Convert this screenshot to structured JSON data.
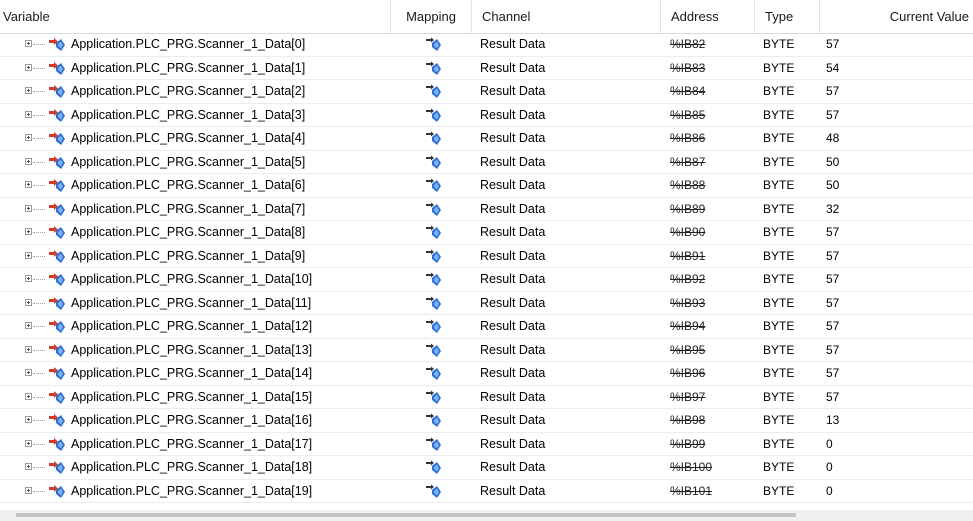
{
  "columns": {
    "variable": "Variable",
    "mapping": "Mapping",
    "channel": "Channel",
    "address": "Address",
    "type": "Type",
    "current_value": "Current Value"
  },
  "icons": {
    "variable": "variable-input-icon",
    "mapping": "mapping-arrow-icon",
    "expander": "plus-expander-icon"
  },
  "colors": {
    "icon_blue": "#2b6fd6",
    "icon_red": "#d23c2a"
  },
  "rows": [
    {
      "variable": "Application.PLC_PRG.Scanner_1_Data[0]",
      "channel": "Result Data",
      "address": "%IB82",
      "type": "BYTE",
      "value": "57"
    },
    {
      "variable": "Application.PLC_PRG.Scanner_1_Data[1]",
      "channel": "Result Data",
      "address": "%IB83",
      "type": "BYTE",
      "value": "54"
    },
    {
      "variable": "Application.PLC_PRG.Scanner_1_Data[2]",
      "channel": "Result Data",
      "address": "%IB84",
      "type": "BYTE",
      "value": "57"
    },
    {
      "variable": "Application.PLC_PRG.Scanner_1_Data[3]",
      "channel": "Result Data",
      "address": "%IB85",
      "type": "BYTE",
      "value": "57"
    },
    {
      "variable": "Application.PLC_PRG.Scanner_1_Data[4]",
      "channel": "Result Data",
      "address": "%IB86",
      "type": "BYTE",
      "value": "48"
    },
    {
      "variable": "Application.PLC_PRG.Scanner_1_Data[5]",
      "channel": "Result Data",
      "address": "%IB87",
      "type": "BYTE",
      "value": "50"
    },
    {
      "variable": "Application.PLC_PRG.Scanner_1_Data[6]",
      "channel": "Result Data",
      "address": "%IB88",
      "type": "BYTE",
      "value": "50"
    },
    {
      "variable": "Application.PLC_PRG.Scanner_1_Data[7]",
      "channel": "Result Data",
      "address": "%IB89",
      "type": "BYTE",
      "value": "32"
    },
    {
      "variable": "Application.PLC_PRG.Scanner_1_Data[8]",
      "channel": "Result Data",
      "address": "%IB90",
      "type": "BYTE",
      "value": "57"
    },
    {
      "variable": "Application.PLC_PRG.Scanner_1_Data[9]",
      "channel": "Result Data",
      "address": "%IB91",
      "type": "BYTE",
      "value": "57"
    },
    {
      "variable": "Application.PLC_PRG.Scanner_1_Data[10]",
      "channel": "Result Data",
      "address": "%IB92",
      "type": "BYTE",
      "value": "57"
    },
    {
      "variable": "Application.PLC_PRG.Scanner_1_Data[11]",
      "channel": "Result Data",
      "address": "%IB93",
      "type": "BYTE",
      "value": "57"
    },
    {
      "variable": "Application.PLC_PRG.Scanner_1_Data[12]",
      "channel": "Result Data",
      "address": "%IB94",
      "type": "BYTE",
      "value": "57"
    },
    {
      "variable": "Application.PLC_PRG.Scanner_1_Data[13]",
      "channel": "Result Data",
      "address": "%IB95",
      "type": "BYTE",
      "value": "57"
    },
    {
      "variable": "Application.PLC_PRG.Scanner_1_Data[14]",
      "channel": "Result Data",
      "address": "%IB96",
      "type": "BYTE",
      "value": "57"
    },
    {
      "variable": "Application.PLC_PRG.Scanner_1_Data[15]",
      "channel": "Result Data",
      "address": "%IB97",
      "type": "BYTE",
      "value": "57"
    },
    {
      "variable": "Application.PLC_PRG.Scanner_1_Data[16]",
      "channel": "Result Data",
      "address": "%IB98",
      "type": "BYTE",
      "value": "13"
    },
    {
      "variable": "Application.PLC_PRG.Scanner_1_Data[17]",
      "channel": "Result Data",
      "address": "%IB99",
      "type": "BYTE",
      "value": "0"
    },
    {
      "variable": "Application.PLC_PRG.Scanner_1_Data[18]",
      "channel": "Result Data",
      "address": "%IB100",
      "type": "BYTE",
      "value": "0"
    },
    {
      "variable": "Application.PLC_PRG.Scanner_1_Data[19]",
      "channel": "Result Data",
      "address": "%IB101",
      "type": "BYTE",
      "value": "0"
    }
  ]
}
